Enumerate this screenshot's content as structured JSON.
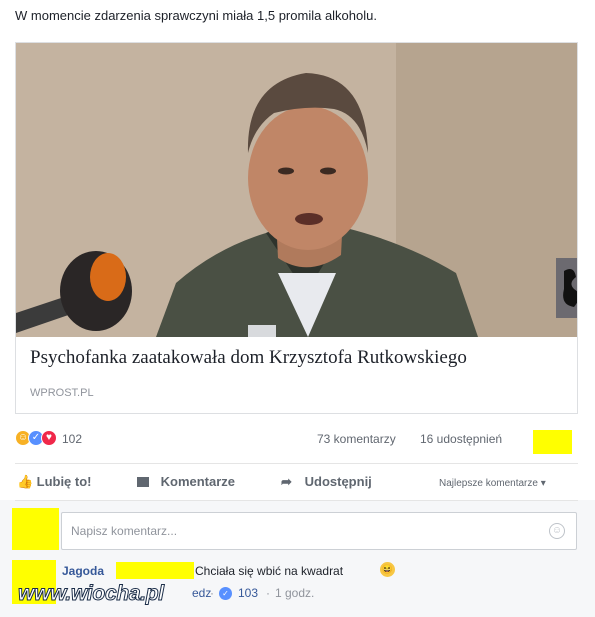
{
  "post": {
    "text": "W momencie zdarzenia sprawczyni miała 1,5 promila alkoholu."
  },
  "link": {
    "title": "Psychofanka zaatakowała dom Krzysztofa Rutkowskiego",
    "domain": "WPROST.PL"
  },
  "reactions": {
    "count": "102",
    "comments": "73 komentarzy",
    "shares": "16 udostępnień"
  },
  "actions": {
    "like": "Lubię to!",
    "comment": "Komentarze",
    "share": "Udostępnij",
    "sort": "Najlepsze komentarze"
  },
  "composer": {
    "placeholder": "Napisz komentarz..."
  },
  "comment": {
    "author": "Jagoda",
    "text": "Chciała się wbić na kwadrat",
    "reply_fragment": "edz",
    "likes": "103",
    "time": "1 godz."
  },
  "watermark": "www.wiocha.pl",
  "colors": {
    "link_blue": "#365899",
    "censor_yellow": "#ffff00"
  }
}
